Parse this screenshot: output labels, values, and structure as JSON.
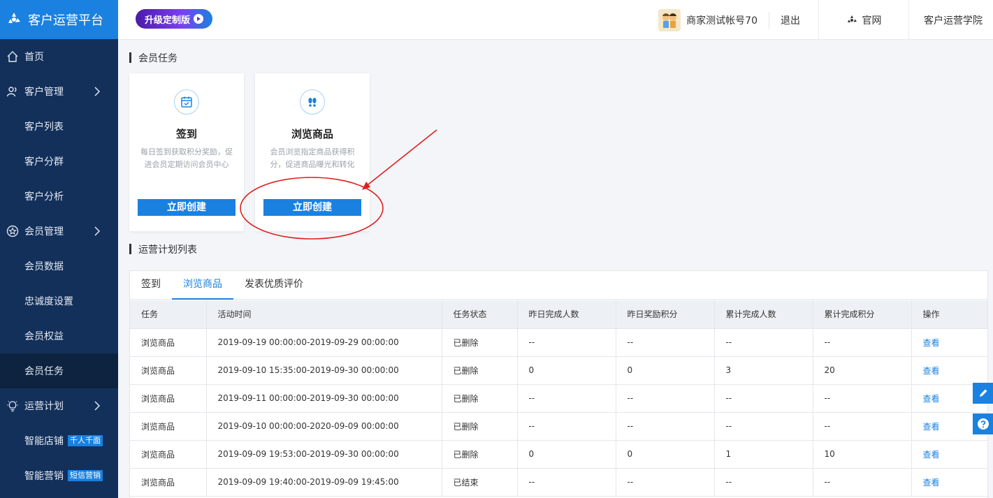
{
  "app": {
    "brand": "客户运营平台"
  },
  "sidebar": {
    "items": [
      {
        "label": "首页"
      },
      {
        "label": "客户管理"
      },
      {
        "label": "客户列表"
      },
      {
        "label": "客户分群"
      },
      {
        "label": "客户分析"
      },
      {
        "label": "会员管理"
      },
      {
        "label": "会员数据"
      },
      {
        "label": "忠诚度设置"
      },
      {
        "label": "会员权益"
      },
      {
        "label": "会员任务"
      },
      {
        "label": "运营计划"
      },
      {
        "label": "智能店铺",
        "tag": "千人千面"
      },
      {
        "label": "智能营销",
        "tag": "短信营销"
      }
    ]
  },
  "header": {
    "upgrade_label": "升级定制版",
    "account_name": "商家测试帐号70",
    "logout": "退出",
    "official_site": "官网",
    "academy": "客户运营学院"
  },
  "main": {
    "task_section_title": "会员任务",
    "cards": [
      {
        "title": "签到",
        "desc": "每日签到获取积分奖励，促进会员定期访问会员中心",
        "button": "立即创建",
        "icon": "calendar-check-icon"
      },
      {
        "title": "浏览商品",
        "desc": "会员浏览指定商品获得积分，促进商品曝光和转化",
        "button": "立即创建",
        "icon": "footprints-icon"
      }
    ],
    "plan_section_title": "运营计划列表",
    "tabs": [
      "签到",
      "浏览商品",
      "发表优质评价"
    ],
    "active_tab": "浏览商品",
    "table": {
      "headers": [
        "任务",
        "活动时间",
        "任务状态",
        "昨日完成人数",
        "昨日奖励积分",
        "累计完成人数",
        "累计完成积分",
        "操作"
      ],
      "rows": [
        [
          "浏览商品",
          "2019-09-19 00:00:00-2019-09-29 00:00:00",
          "已删除",
          "--",
          "--",
          "--",
          "--",
          "查看"
        ],
        [
          "浏览商品",
          "2019-09-10 15:35:00-2019-09-30 00:00:00",
          "已删除",
          "0",
          "0",
          "3",
          "20",
          "查看"
        ],
        [
          "浏览商品",
          "2019-09-11 00:00:00-2019-09-30 00:00:00",
          "已删除",
          "--",
          "--",
          "--",
          "--",
          "查看"
        ],
        [
          "浏览商品",
          "2019-09-10 00:00:00-2020-09-09 00:00:00",
          "已删除",
          "--",
          "--",
          "--",
          "--",
          "查看"
        ],
        [
          "浏览商品",
          "2019-09-09 19:53:00-2019-09-30 00:00:00",
          "已删除",
          "0",
          "0",
          "1",
          "10",
          "查看"
        ],
        [
          "浏览商品",
          "2019-09-09 19:40:00-2019-09-09 19:45:00",
          "已结束",
          "--",
          "--",
          "--",
          "--",
          "查看"
        ]
      ]
    }
  },
  "floating": {
    "edit_icon": "pencil-icon",
    "help_icon": "question-icon"
  },
  "colors": {
    "sidebar_bg": "#13305a",
    "brand_blue": "#1a81e0",
    "annotation_red": "#e02020"
  }
}
